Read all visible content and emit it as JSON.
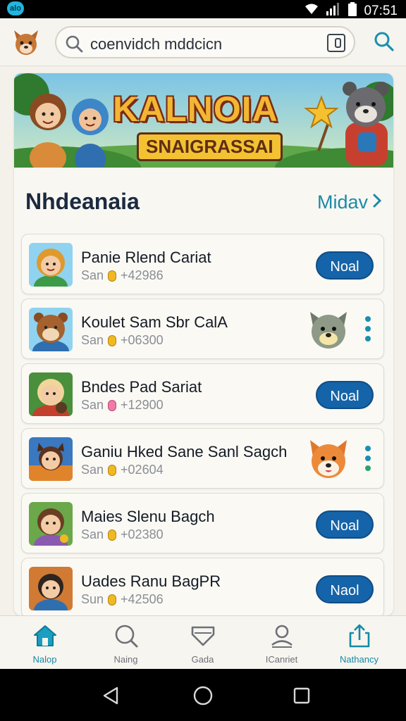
{
  "status_bar": {
    "app_badge": "alo",
    "time": "07:51"
  },
  "search": {
    "value": "coenvidch mddcicn"
  },
  "banner": {
    "title": "KALNOIA",
    "subtitle": "SNAIGRASSAI"
  },
  "section": {
    "title": "Nhdeanaia",
    "more_label": "Midav"
  },
  "items": [
    {
      "title": "Panie Rlend Cariat",
      "meta_prefix": "San",
      "meta_value": "+42986",
      "coin": "gold",
      "action": "Noal"
    },
    {
      "title": "Koulet Sam Sbr CalA",
      "meta_prefix": "San",
      "meta_value": "+06300",
      "coin": "gold",
      "action": ""
    },
    {
      "title": "Bndes Pad Sariat",
      "meta_prefix": "San",
      "meta_value": "+12900",
      "coin": "pink",
      "action": "Noal"
    },
    {
      "title": "Ganiu Hked Sane Sanl Sagch",
      "meta_prefix": "San",
      "meta_value": "+02604",
      "coin": "gold",
      "action": ""
    },
    {
      "title": "Maies Slenu Bagch",
      "meta_prefix": "San",
      "meta_value": "+02380",
      "coin": "gold",
      "action": "Noal"
    },
    {
      "title": "Uades Ranu BagPR",
      "meta_prefix": "Sun",
      "meta_value": "+42506",
      "coin": "gold",
      "action": "Naol"
    }
  ],
  "tabs": [
    {
      "label": "Nalop",
      "icon": "home-icon"
    },
    {
      "label": "Naing",
      "icon": "search-icon"
    },
    {
      "label": "Gada",
      "icon": "tag-icon"
    },
    {
      "label": "ICanriet",
      "icon": "person-icon"
    },
    {
      "label": "Nathancy",
      "icon": "share-icon"
    }
  ],
  "colors": {
    "accent": "#1563a8",
    "teal": "#1c8aa6",
    "background": "#f3f1ea"
  }
}
